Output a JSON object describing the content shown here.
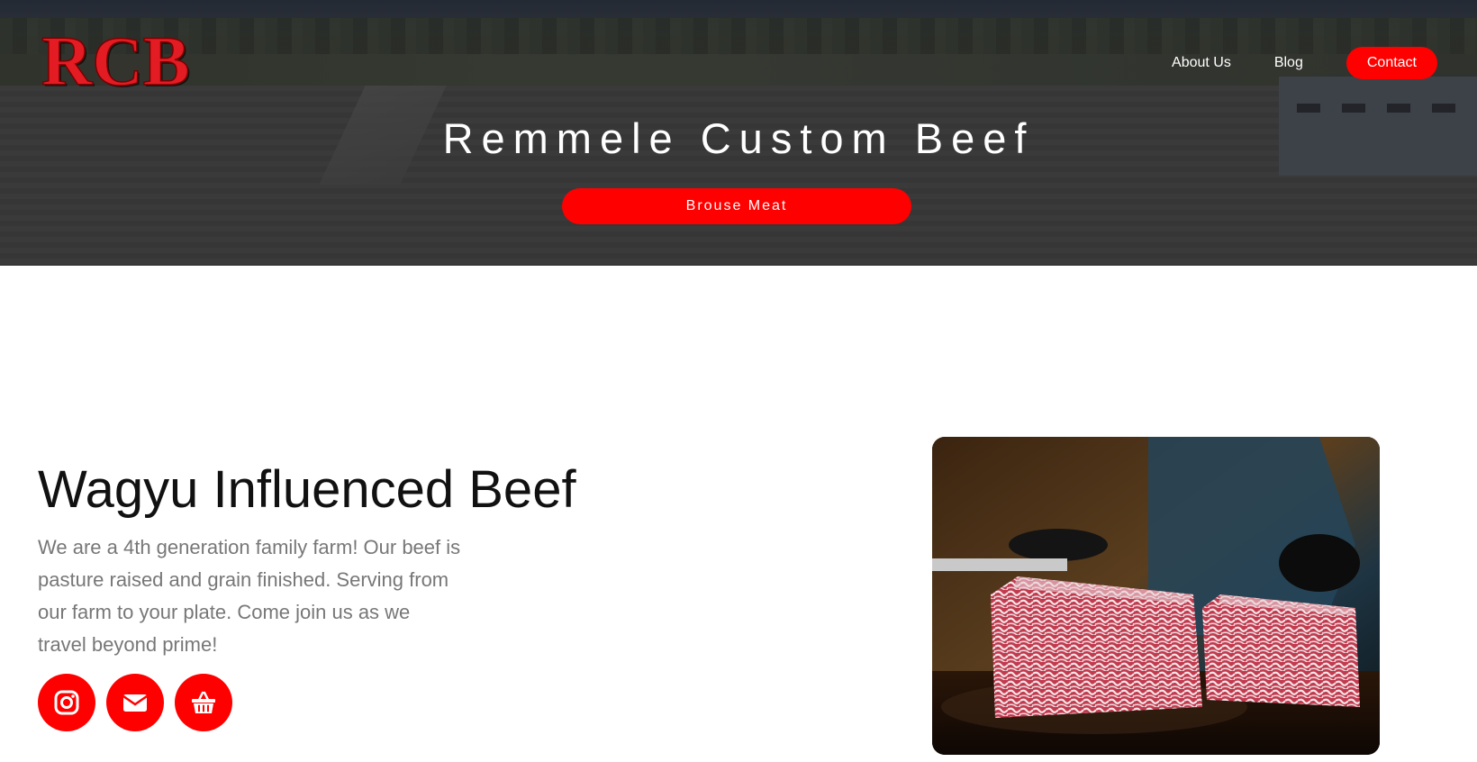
{
  "brand": {
    "logo_text": "RCB",
    "accent_color": "#ff0000"
  },
  "nav": {
    "about_label": "About Us",
    "blog_label": "Blog",
    "contact_label": "Contact"
  },
  "hero": {
    "title": "Remmele Custom Beef",
    "cta_label": "Brouse Meat"
  },
  "intro": {
    "title": "Wagyu Influenced Beef",
    "body": "We are a 4th generation family farm! Our beef is pasture raised and grain finished. Serving from our farm to your plate. Come join us as we travel beyond prime!"
  },
  "social": {
    "icons": [
      "instagram-icon",
      "email-icon",
      "shopping-basket-icon"
    ]
  },
  "photo": {
    "subject": "marbled-wagyu-beef"
  }
}
